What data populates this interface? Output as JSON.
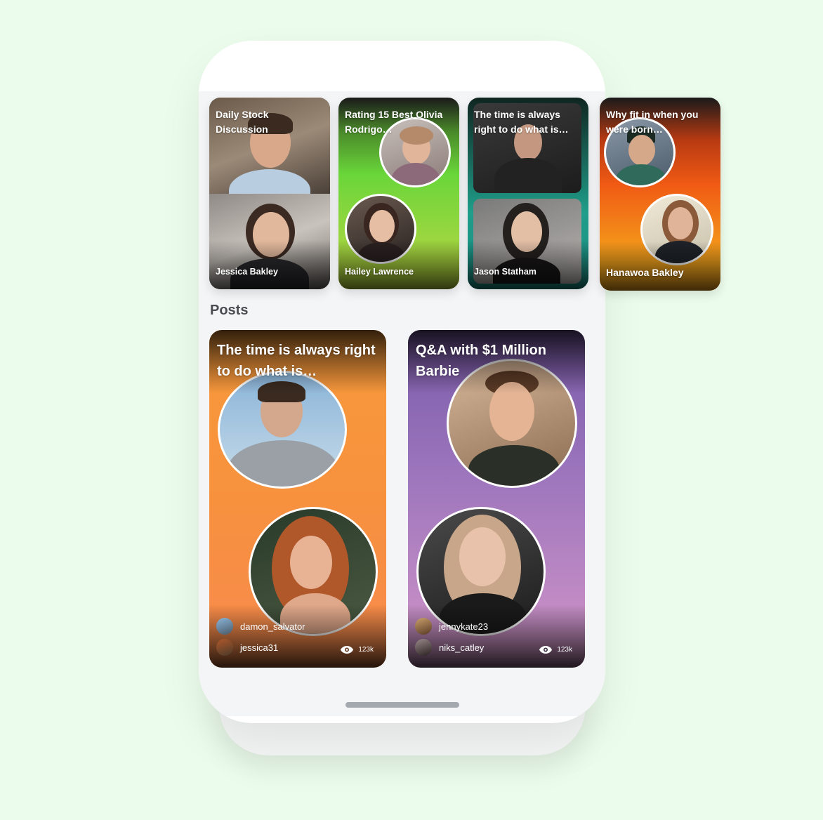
{
  "stories": [
    {
      "title": "Daily Stock Discussion",
      "name": "Jessica Bakley"
    },
    {
      "title": "Rating 15 Best Olivia Rodrigo…",
      "name": "Hailey Lawrence"
    },
    {
      "title": "The time is always right to do what is…",
      "name": "Jason Statham"
    },
    {
      "title": "Why fit in when you were born…",
      "name": "Hanawoa Bakley"
    }
  ],
  "section_title": "Posts",
  "posts": [
    {
      "title": "The time is always right to do what is…",
      "user1": "damon_salvator",
      "user2": "jessica31",
      "views": "123k"
    },
    {
      "title": "Q&A with $1 Million Barbie",
      "user1": "jennykate23",
      "user2": "niks_catley",
      "views": "123k"
    }
  ],
  "icons": {
    "views": "eye-icon"
  },
  "colors": {
    "background": "#ecfcec",
    "screen": "#f4f5f7",
    "story2_gradient": [
      "#6ad63a",
      "#b6d63a"
    ],
    "story3_border": "#1f9e8a",
    "story4_gradient": [
      "#f05a14",
      "#f5a41c"
    ],
    "post1_gradient": [
      "#f79a3a",
      "#f78a4e"
    ],
    "post2_gradient": [
      "#8a6bbf",
      "#d49ac8"
    ]
  }
}
